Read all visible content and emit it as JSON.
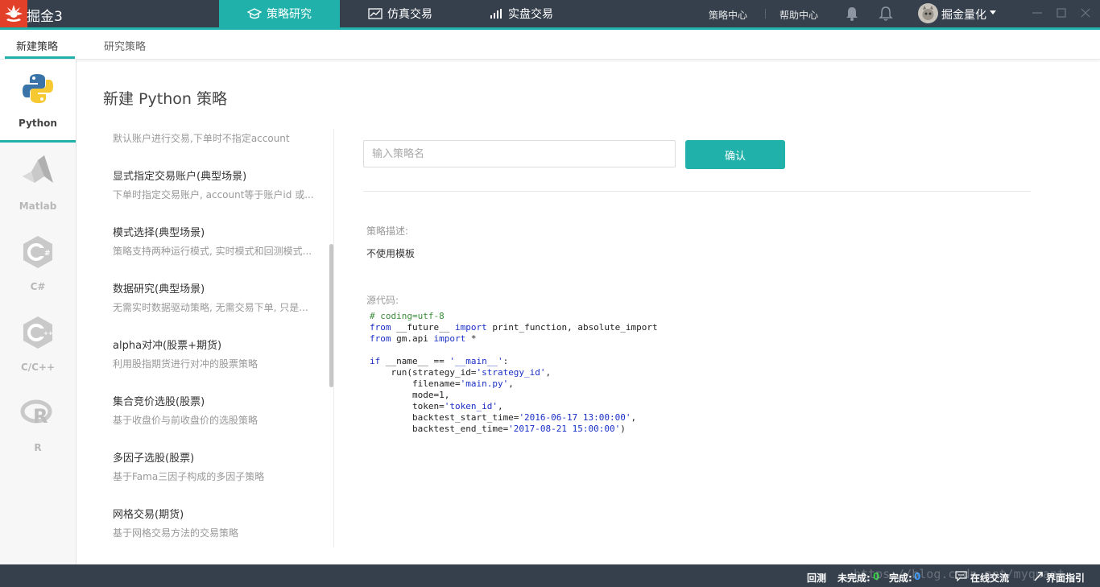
{
  "app": {
    "title": "掘金3"
  },
  "nav": {
    "tabs": [
      {
        "label": "策略研究",
        "icon": "graduation-cap-icon"
      },
      {
        "label": "仿真交易",
        "icon": "line-chart-icon"
      },
      {
        "label": "实盘交易",
        "icon": "bar-chart-icon"
      }
    ],
    "active_tab": 0,
    "links": {
      "strategy_center": "策略中心",
      "help_center": "帮助中心"
    },
    "user": {
      "name": "掘金量化"
    }
  },
  "subtabs": {
    "items": [
      "新建策略",
      "研究策略"
    ],
    "active": 0
  },
  "languages": {
    "items": [
      "Python",
      "Matlab",
      "C#",
      "C/C++",
      "R"
    ],
    "active": 0
  },
  "main": {
    "title": "新建 Python 策略",
    "templates": [
      {
        "title": "",
        "desc": "默认账户进行交易,下单时不指定account"
      },
      {
        "title": "显式指定交易账户(典型场景)",
        "desc": "下单时指定交易账户, account等于账户id 或..."
      },
      {
        "title": "模式选择(典型场景)",
        "desc": "策略支持两种运行模式, 实时模式和回测模式..."
      },
      {
        "title": "数据研究(典型场景)",
        "desc": "无需实时数据驱动策略, 无需交易下单, 只是..."
      },
      {
        "title": "alpha对冲(股票+期货)",
        "desc": "利用股指期货进行对冲的股票策略"
      },
      {
        "title": "集合竞价选股(股票)",
        "desc": "基于收盘价与前收盘价的选股策略"
      },
      {
        "title": "多因子选股(股票)",
        "desc": "基于Fama三因子构成的多因子策略"
      },
      {
        "title": "网格交易(期货)",
        "desc": "基于网格交易方法的交易策略"
      }
    ],
    "name_input": {
      "placeholder": "输入策略名",
      "value": ""
    },
    "confirm_label": "确认",
    "desc_label": "策略描述:",
    "desc_value": "不使用模板",
    "source_label": "源代码:"
  },
  "status": {
    "backtest": "回测",
    "incomplete_label": "未完成:",
    "incomplete_count": "0",
    "complete_label": "完成:",
    "complete_count": "0",
    "online_chat": "在线交流",
    "ui_guide": "界面指引",
    "watermark": "https://blog.csdn.net/myquant"
  },
  "colors": {
    "accent": "#20b2aa",
    "topbar": "#36404d",
    "logo": "#e3402a"
  }
}
